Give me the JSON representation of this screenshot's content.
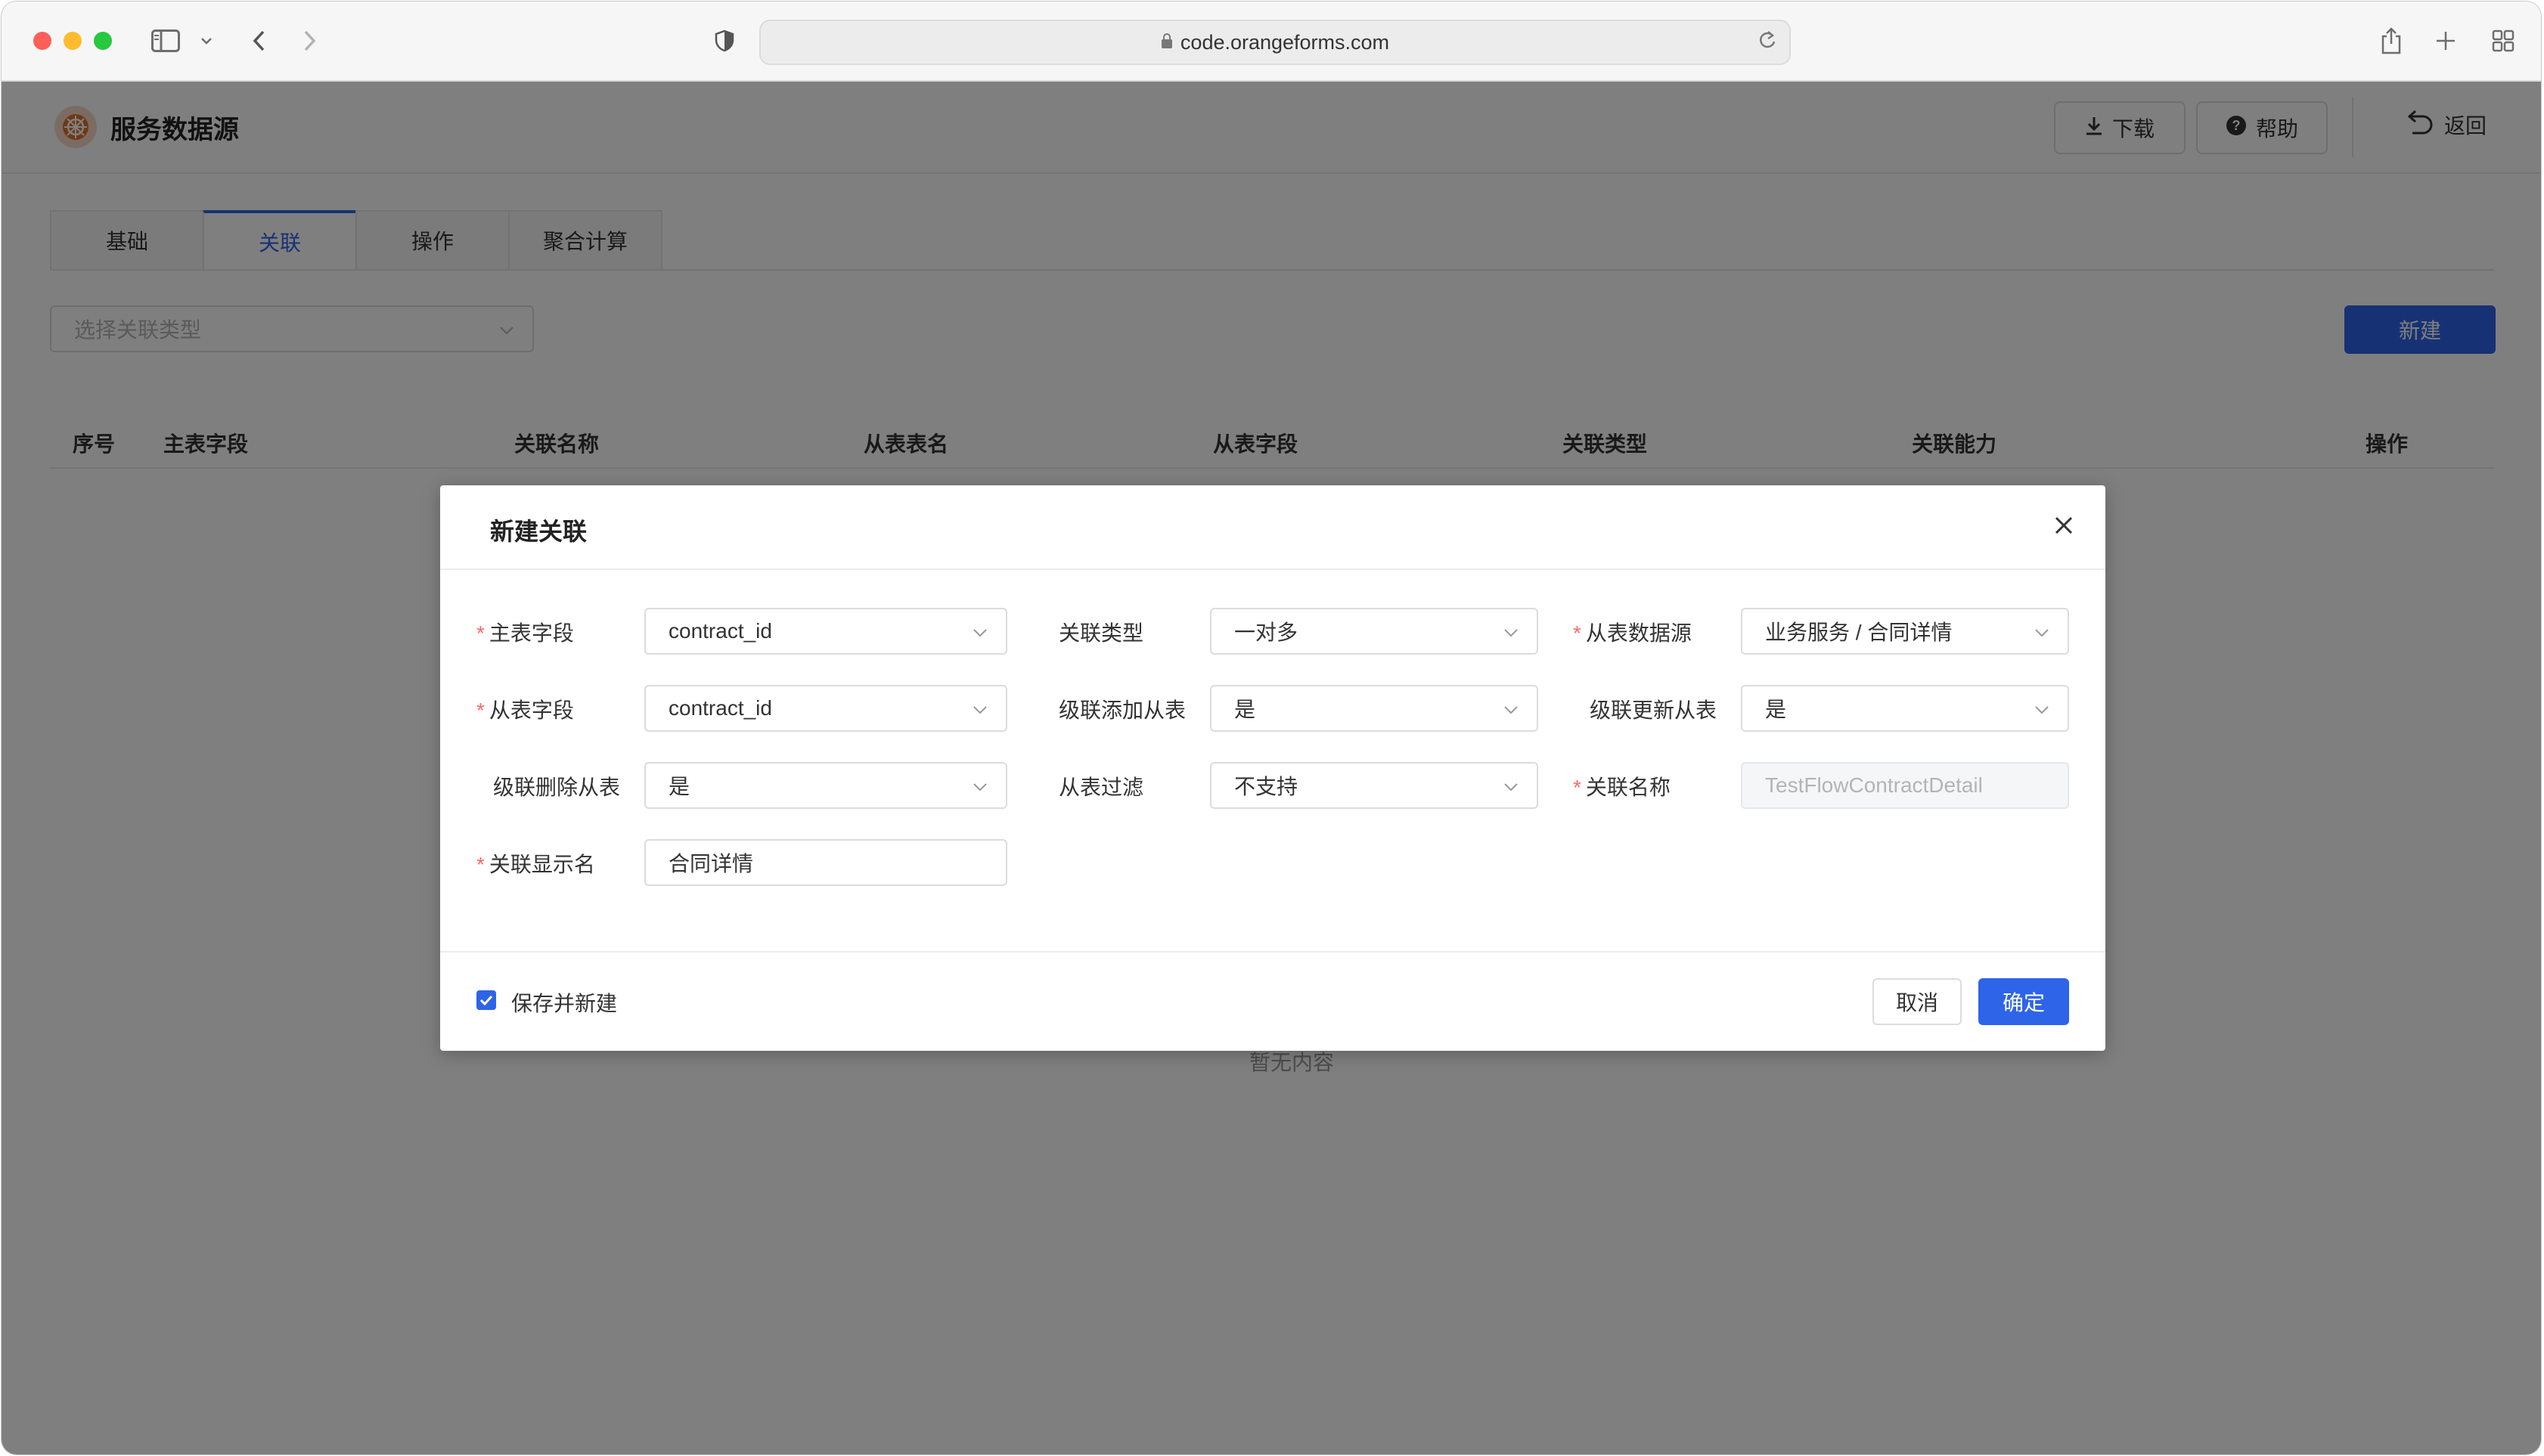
{
  "browser": {
    "url": "code.orangeforms.com"
  },
  "header": {
    "title": "服务数据源",
    "download_label": "下载",
    "help_label": "帮助",
    "back_label": "返回"
  },
  "tabs": [
    {
      "label": "基础",
      "active": false
    },
    {
      "label": "关联",
      "active": true
    },
    {
      "label": "操作",
      "active": false
    },
    {
      "label": "聚合计算",
      "active": false
    }
  ],
  "toolbar": {
    "relation_type_placeholder": "选择关联类型",
    "new_label": "新建"
  },
  "table": {
    "columns": [
      "序号",
      "主表字段",
      "关联名称",
      "从表表名",
      "从表字段",
      "关联类型",
      "关联能力",
      "操作"
    ],
    "empty_text": "暂无内容"
  },
  "dialog": {
    "title": "新建关联",
    "fields": {
      "master_field": {
        "label": "主表字段",
        "required": true,
        "value": "contract_id"
      },
      "relation_type": {
        "label": "关联类型",
        "required": false,
        "value": "一对多"
      },
      "slave_datasource": {
        "label": "从表数据源",
        "required": true,
        "value": "业务服务 / 合同详情"
      },
      "slave_field": {
        "label": "从表字段",
        "required": true,
        "value": "contract_id"
      },
      "cascade_add": {
        "label": "级联添加从表",
        "required": false,
        "value": "是"
      },
      "cascade_update": {
        "label": "级联更新从表",
        "required": false,
        "value": "是"
      },
      "cascade_delete": {
        "label": "级联删除从表",
        "required": false,
        "value": "是"
      },
      "slave_filter": {
        "label": "从表过滤",
        "required": false,
        "value": "不支持"
      },
      "relation_name": {
        "label": "关联名称",
        "required": true,
        "value": "TestFlowContractDetail"
      },
      "display_name": {
        "label": "关联显示名",
        "required": true,
        "value": "合同详情"
      }
    },
    "save_and_new_label": "保存并新建",
    "save_and_new_checked": true,
    "cancel_label": "取消",
    "ok_label": "确定"
  },
  "colors": {
    "primary": "#2e64e8",
    "required": "#f56c6c"
  }
}
